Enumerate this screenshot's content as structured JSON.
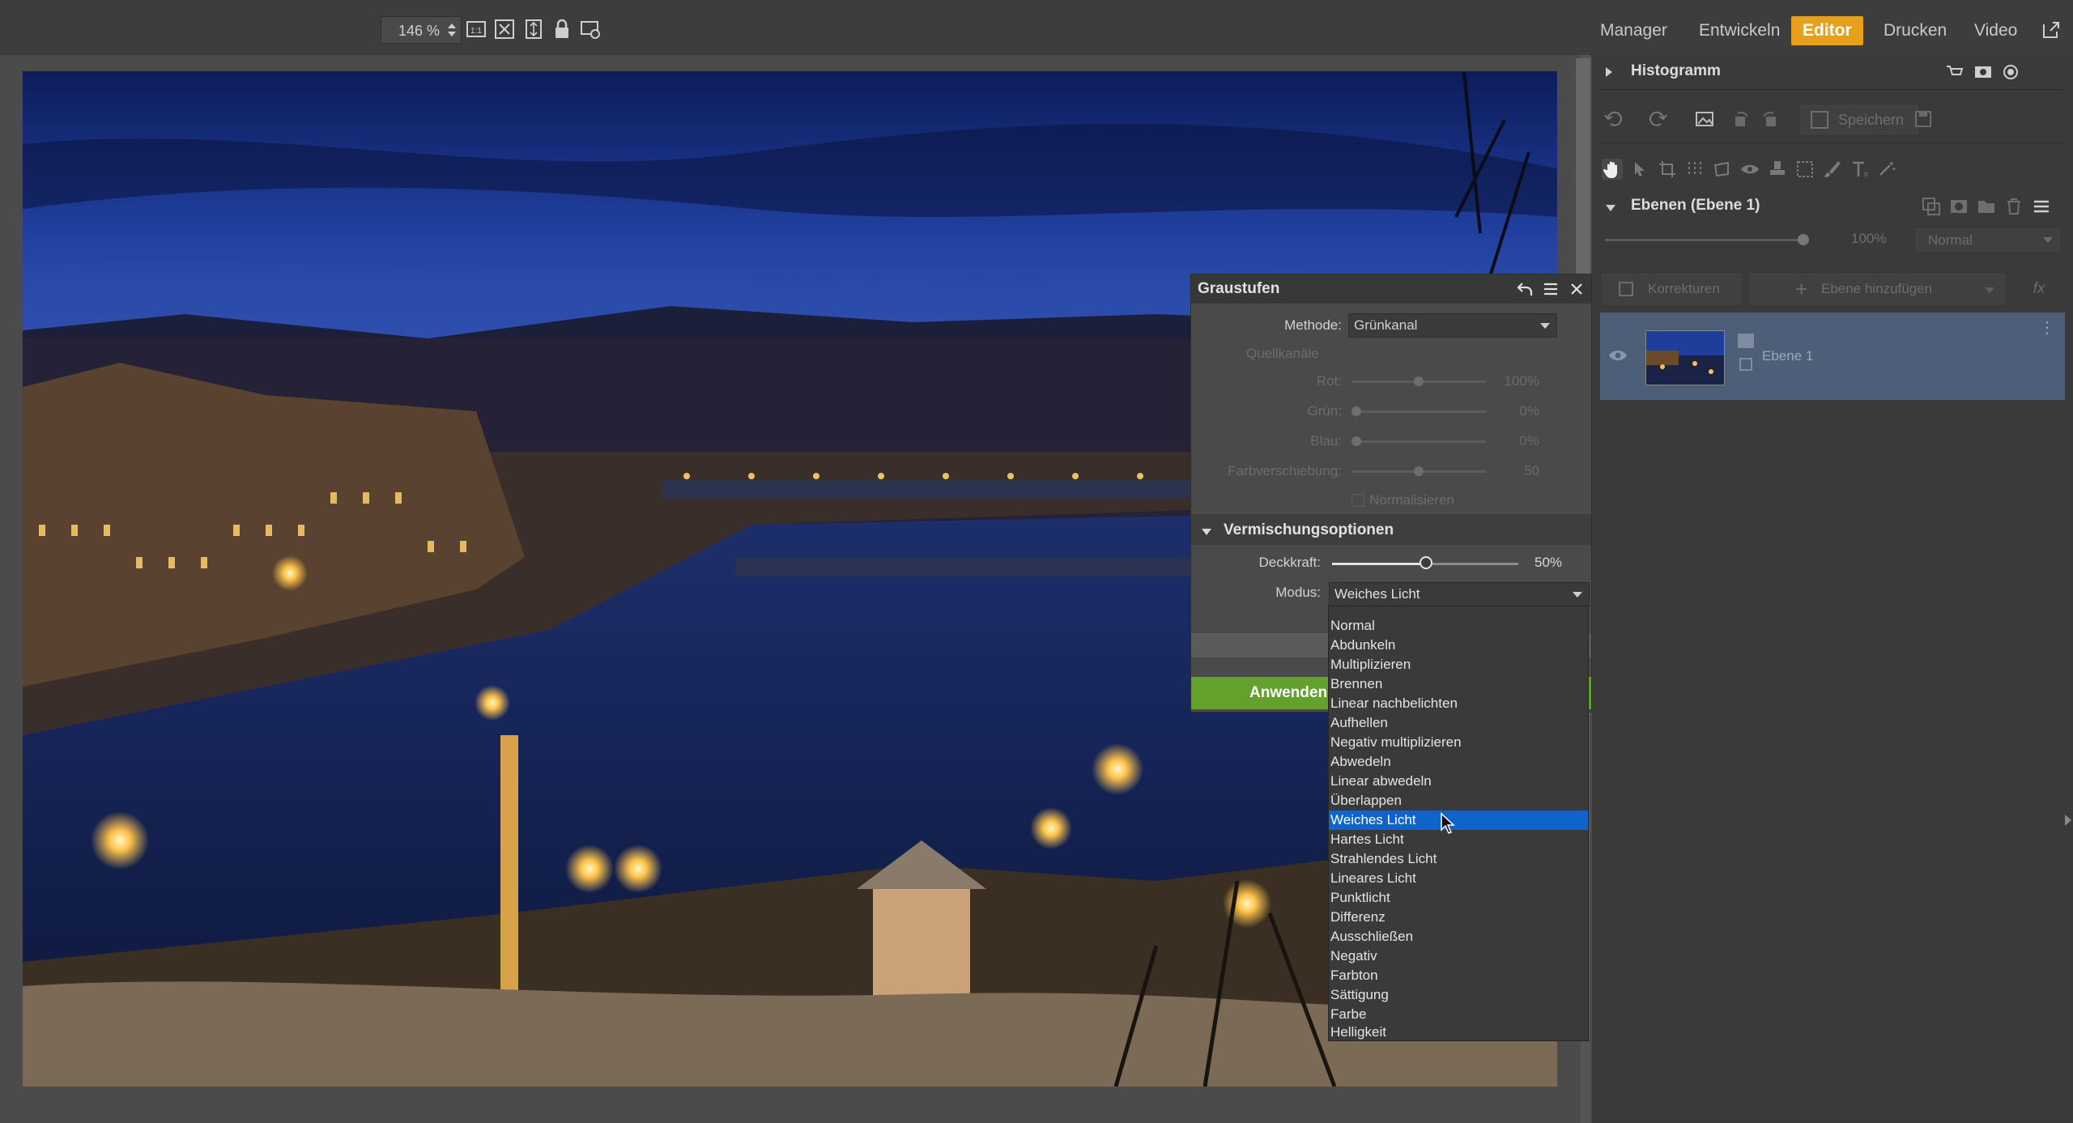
{
  "toolbar": {
    "zoom_value": "146 %",
    "tabs": [
      "Manager",
      "Entwickeln",
      "Editor",
      "Drucken",
      "Video"
    ],
    "active_tab": "Editor",
    "accent_color": "#e6a01c"
  },
  "right_panel": {
    "histogram_title": "Histogramm",
    "save_label": "Speichern",
    "layers_title": "Ebenen (Ebene 1)",
    "layer_opacity": "100%",
    "layer_blend_mode": "Normal",
    "corrections_label": "Korrekturen",
    "add_layer_label": "Ebene hinzufügen",
    "fx_label": "fx",
    "layer_name": "Ebene 1",
    "layer_row_color": "#4d5e78"
  },
  "dialog": {
    "title": "Graustufen",
    "method_label": "Methode:",
    "method_value": "Grünkanal",
    "source_channels_label": "Quellkanäle",
    "channels": [
      {
        "label": "Rot:",
        "value": "100%",
        "level": 0.5
      },
      {
        "label": "Grün:",
        "value": "0%",
        "level": 0.0
      },
      {
        "label": "Blau:",
        "value": "0%",
        "level": 0.0
      },
      {
        "label": "Farbverschiebung:",
        "value": "50",
        "level": 0.5
      }
    ],
    "normalize_label": "Normalisieren",
    "blend_section_title": "Vermischungsoptionen",
    "opacity_label": "Deckkraft:",
    "opacity_value": "50%",
    "opacity_level": 0.5,
    "mode_label": "Modus:",
    "mode_value": "Weiches Licht",
    "apply_label": "Anwenden",
    "apply_color": "#64a02c"
  },
  "mode_dropdown": {
    "selected": "Weiches Licht",
    "selected_color": "#0f64cc",
    "options": [
      "Normal",
      "Abdunkeln",
      "Multiplizieren",
      "Brennen",
      "Linear nachbelichten",
      "Aufhellen",
      "Negativ multiplizieren",
      "Abwedeln",
      "Linear abwedeln",
      "Überlappen",
      "Weiches Licht",
      "Hartes Licht",
      "Strahlendes Licht",
      "Lineares Licht",
      "Punktlicht",
      "Differenz",
      "Ausschließen",
      "Negativ",
      "Farbton",
      "Sättigung",
      "Farbe",
      "Helligkeit"
    ]
  }
}
